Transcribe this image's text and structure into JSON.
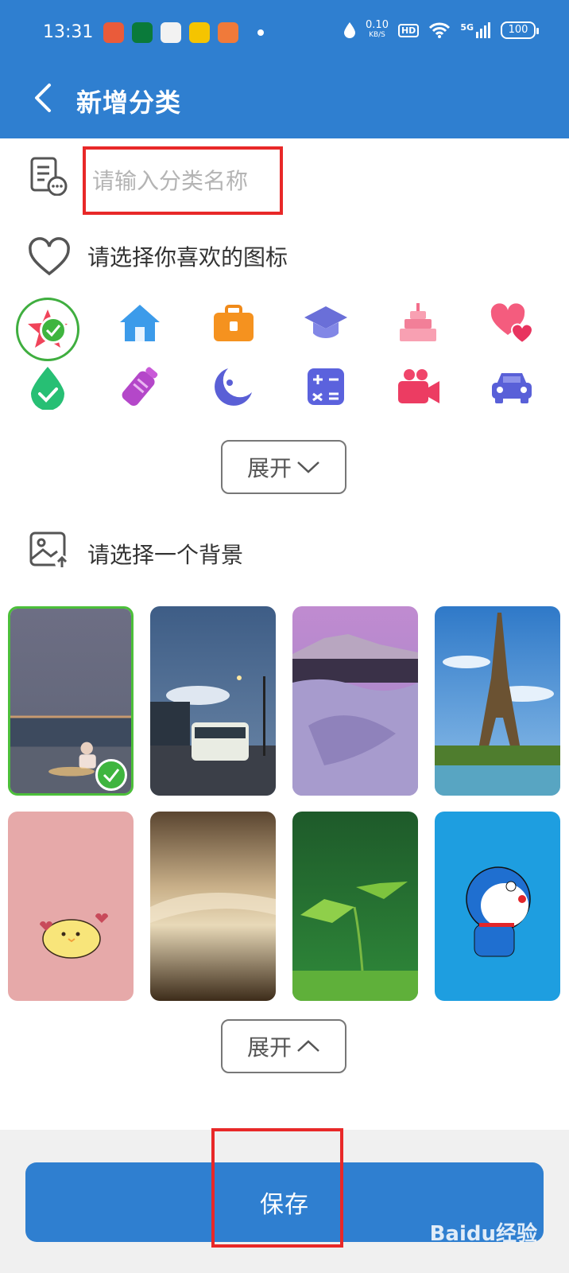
{
  "status_bar": {
    "time": "13:31",
    "net_speed": "0.10",
    "net_unit": "KB/S",
    "hd": "HD",
    "signal": "5G",
    "battery": "100"
  },
  "header": {
    "title": "新增分类"
  },
  "name_input": {
    "placeholder": "请输入分类名称"
  },
  "icon_section": {
    "label": "请选择你喜欢的图标",
    "icons": [
      "star-icon",
      "home-icon",
      "briefcase-icon",
      "graduation-cap-icon",
      "cake-icon",
      "hearts-icon",
      "drop-check-icon",
      "bottle-icon",
      "moon-icon",
      "calculator-icon",
      "video-camera-icon",
      "car-icon"
    ],
    "expand_label": "展开"
  },
  "background_section": {
    "label": "请选择一个背景",
    "collapse_label": "展开"
  },
  "footer": {
    "save_label": "保存"
  },
  "watermark": "Baidu经验",
  "colors": {
    "primary": "#2f7fd0",
    "selected": "#3fb53f",
    "highlight": "#e82828"
  }
}
